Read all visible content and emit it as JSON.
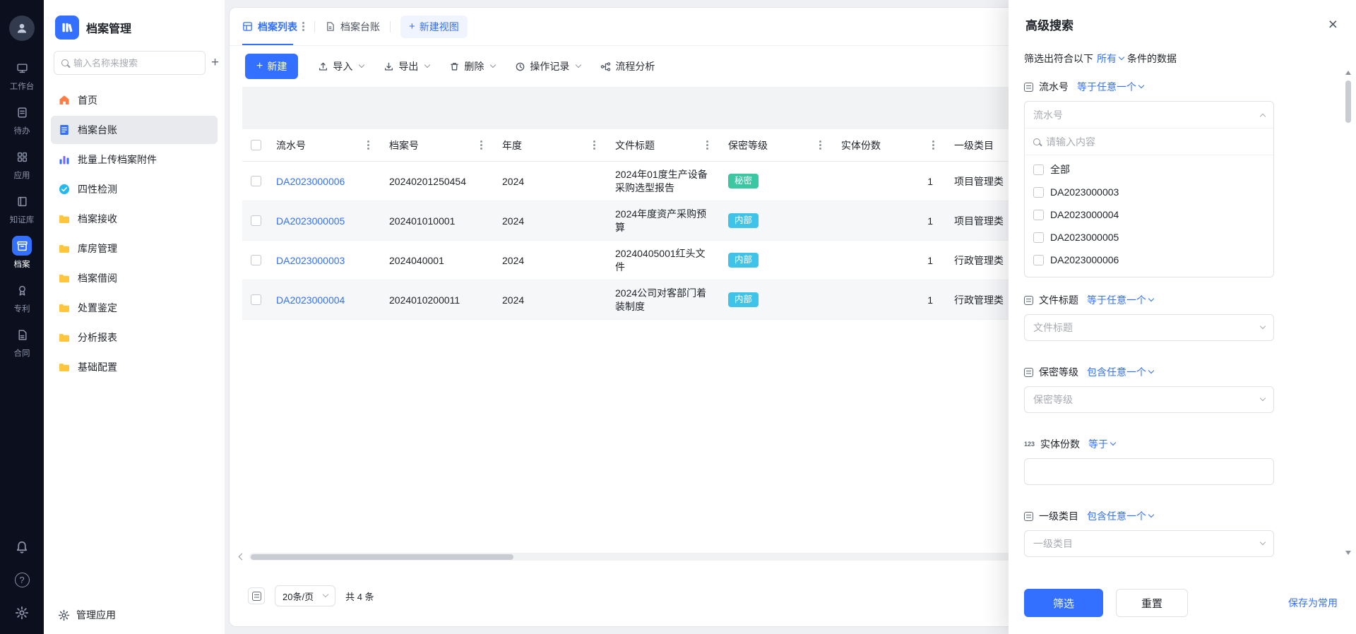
{
  "colors": {
    "primary": "#3370ff",
    "badge_secret": "#3ac7a2",
    "badge_internal": "#3fc3e8",
    "rail_bg": "#0b0f1e"
  },
  "icons": {
    "search": "magnifier",
    "plus": "+",
    "close": "×",
    "help": "?",
    "column_menu": "⋮",
    "chevron": "v"
  },
  "nav_rail": {
    "items": [
      {
        "label": "工作台"
      },
      {
        "label": "待办"
      },
      {
        "label": "应用"
      },
      {
        "label": "知证库"
      },
      {
        "label": "档案",
        "active": true
      },
      {
        "label": "专利"
      },
      {
        "label": "合同"
      }
    ]
  },
  "sidebar": {
    "app_title": "档案管理",
    "search_placeholder": "输入名称来搜索",
    "items": [
      {
        "label": "首页",
        "icon": "home"
      },
      {
        "label": "档案台账",
        "icon": "ledger",
        "active": true
      },
      {
        "label": "批量上传档案附件",
        "icon": "batch-upload"
      },
      {
        "label": "四性检测",
        "icon": "four-check"
      },
      {
        "label": "档案接收",
        "icon": "folder"
      },
      {
        "label": "库房管理",
        "icon": "folder"
      },
      {
        "label": "档案借阅",
        "icon": "folder"
      },
      {
        "label": "处置鉴定",
        "icon": "folder"
      },
      {
        "label": "分析报表",
        "icon": "folder"
      },
      {
        "label": "基础配置",
        "icon": "folder"
      }
    ],
    "footer_label": "管理应用"
  },
  "tabs": [
    {
      "label": "档案列表",
      "active": true
    },
    {
      "label": "档案台账"
    }
  ],
  "new_view_label": "新建视图",
  "toolbar": {
    "new": "新建",
    "import": "导入",
    "export": "导出",
    "delete": "删除",
    "ops_log": "操作记录",
    "flow": "流程分析"
  },
  "table": {
    "columns": [
      "流水号",
      "档案号",
      "年度",
      "文件标题",
      "保密等级",
      "实体份数",
      "一级类目"
    ],
    "rows": [
      {
        "serial": "DA2023000006",
        "archive_no": "20240201250454",
        "year": "2024",
        "title": "2024年01度生产设备采购选型报告",
        "secrecy": "秘密",
        "secrecy_type": "secret",
        "copies": "1",
        "category": "项目管理类"
      },
      {
        "serial": "DA2023000005",
        "archive_no": "202401010001",
        "year": "2024",
        "title": "2024年度资产采购预算",
        "secrecy": "内部",
        "secrecy_type": "internal",
        "copies": "1",
        "category": "项目管理类"
      },
      {
        "serial": "DA2023000003",
        "archive_no": "2024040001",
        "year": "2024",
        "title": "20240405001红头文件",
        "secrecy": "内部",
        "secrecy_type": "internal",
        "copies": "1",
        "category": "行政管理类"
      },
      {
        "serial": "DA2023000004",
        "archive_no": "2024010200011",
        "year": "2024",
        "title": "2024公司对客部门着装制度",
        "secrecy": "内部",
        "secrecy_type": "internal",
        "copies": "1",
        "category": "行政管理类"
      }
    ]
  },
  "pagination": {
    "page_size": "20条/页",
    "total": "共 4 条"
  },
  "drawer": {
    "title": "高级搜索",
    "condition_prefix": "筛选出符合以下",
    "condition_mode": "所有",
    "condition_suffix": "条件的数据",
    "fields": [
      {
        "label": "流水号",
        "operator": "等于任意一个",
        "placeholder": "流水号"
      },
      {
        "label": "文件标题",
        "operator": "等于任意一个",
        "placeholder": "文件标题"
      },
      {
        "label": "保密等级",
        "operator": "包含任意一个",
        "placeholder": "保密等级"
      },
      {
        "label": "实体份数",
        "operator": "等于",
        "placeholder": ""
      },
      {
        "label": "一级类目",
        "operator": "包含任意一个",
        "placeholder": "一级类目"
      }
    ],
    "combobox": {
      "search_placeholder": "请输入内容",
      "options": [
        "全部",
        "DA2023000003",
        "DA2023000004",
        "DA2023000005",
        "DA2023000006"
      ]
    },
    "footer": {
      "filter": "筛选",
      "reset": "重置",
      "save": "保存为常用"
    }
  }
}
